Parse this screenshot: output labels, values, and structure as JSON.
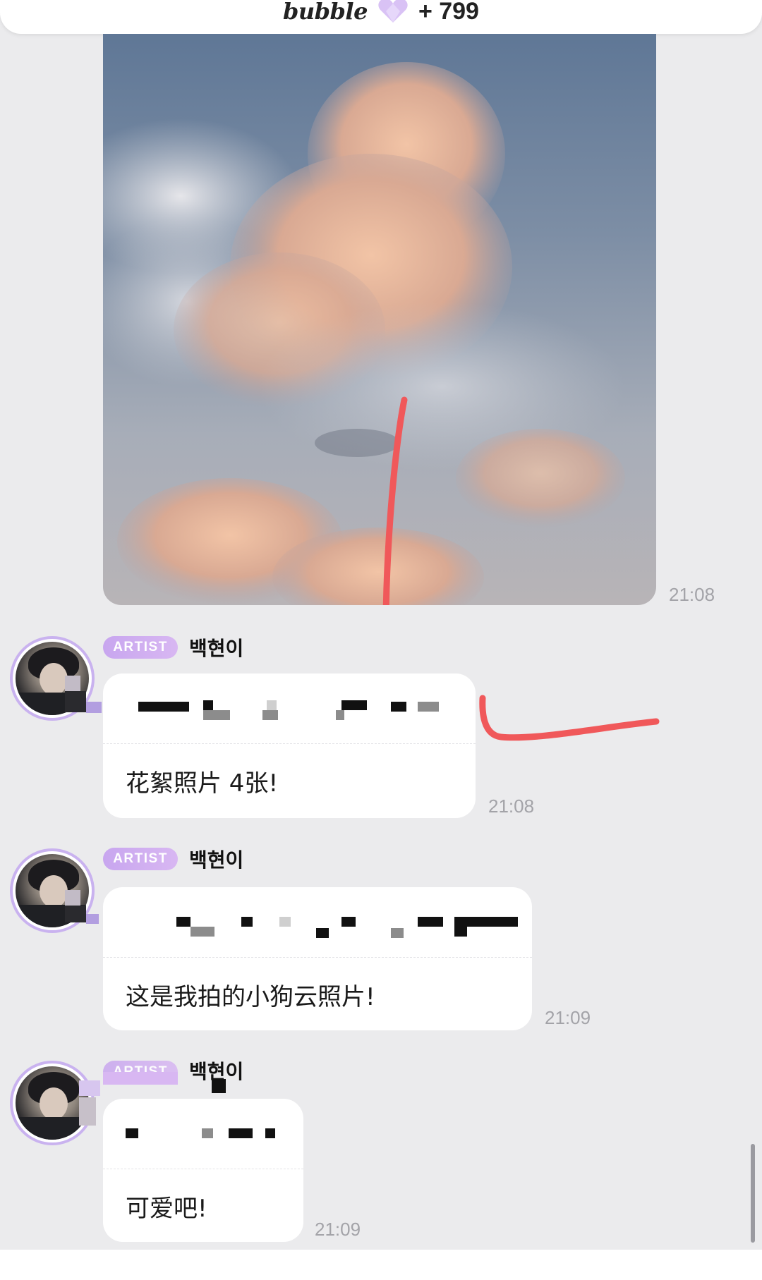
{
  "header": {
    "brand": "bubble",
    "points": "+ 799",
    "accent_color": "#c8a6ef"
  },
  "photo_message": {
    "time": "21:08"
  },
  "messages": [
    {
      "badge": "ARTIST",
      "sender": "백현이",
      "translation": "花絮照片 4张!",
      "time": "21:08"
    },
    {
      "badge": "ARTIST",
      "sender": "백현이",
      "translation": "这是我拍的小狗云照片!",
      "time": "21:09"
    },
    {
      "badge": "ARTIST",
      "sender": "백현이",
      "translation": "可爱吧!",
      "time": "21:09"
    }
  ]
}
